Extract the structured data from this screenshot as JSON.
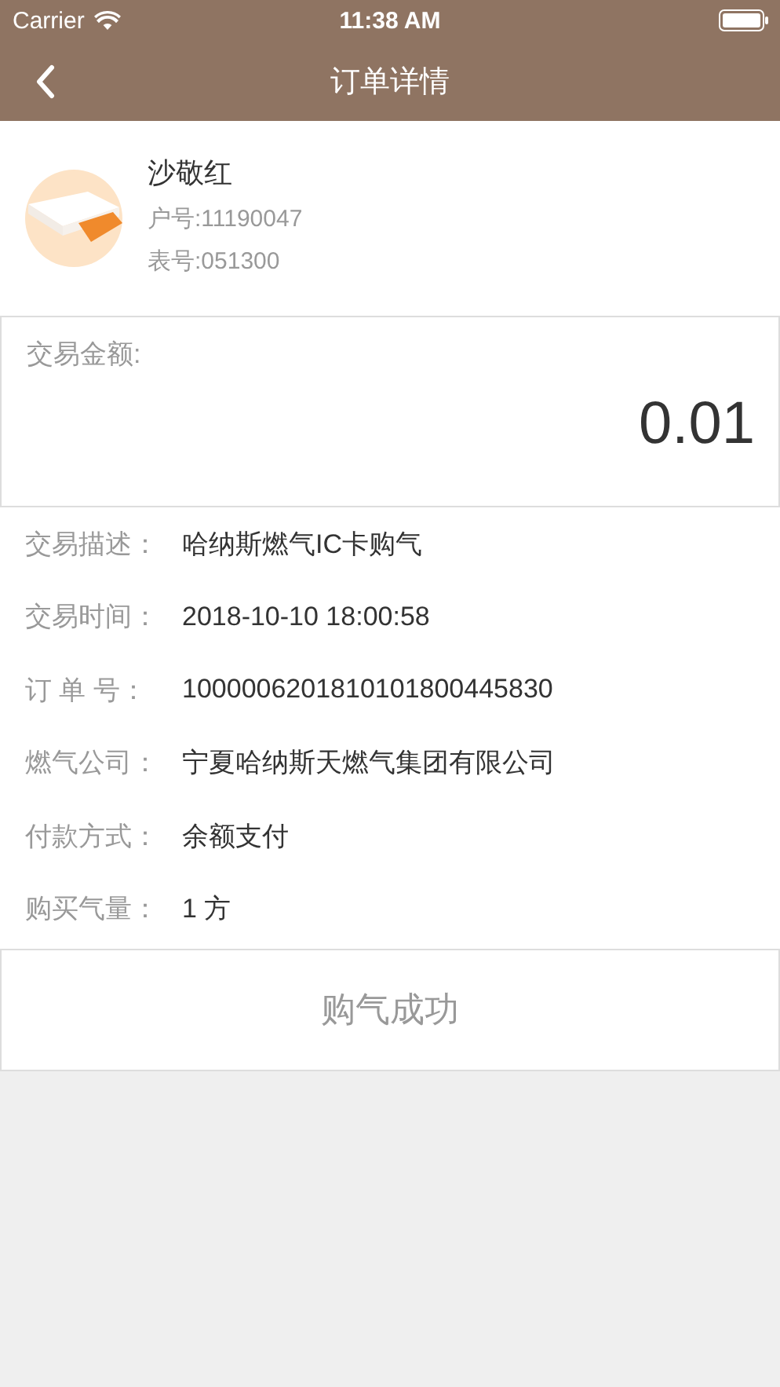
{
  "status_bar": {
    "carrier": "Carrier",
    "time": "11:38 AM"
  },
  "nav": {
    "title": "订单详情"
  },
  "customer": {
    "name": "沙敬红",
    "account": "户号:11190047",
    "meter": "表号:051300"
  },
  "amount": {
    "label": "交易金额:",
    "value": "0.01"
  },
  "details": [
    {
      "label": "交易描述：",
      "value": "哈纳斯燃气IC卡购气"
    },
    {
      "label": "交易时间：",
      "value": "2018-10-10 18:00:58"
    },
    {
      "label": "订 单 号：",
      "value": "1000006201810101800445830"
    },
    {
      "label": "燃气公司：",
      "value": "宁夏哈纳斯天燃气集团有限公司"
    },
    {
      "label": "付款方式：",
      "value": "余额支付"
    },
    {
      "label": "购买气量：",
      "value": "1 方"
    }
  ],
  "result": {
    "text": "购气成功"
  }
}
